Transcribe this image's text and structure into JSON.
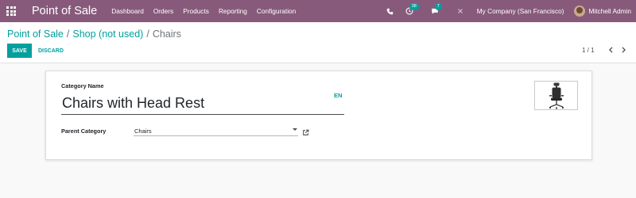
{
  "navbar": {
    "app_title": "Point of Sale",
    "menu": [
      "Dashboard",
      "Orders",
      "Products",
      "Reporting",
      "Configuration"
    ],
    "activity_count": "38",
    "message_count": "7",
    "company": "My Company (San Francisco)",
    "user": "Mitchell Admin",
    "icons": [
      "apps-icon",
      "phone-icon",
      "clock-icon",
      "chat-icon",
      "close-icon",
      "avatar"
    ],
    "colors": {
      "bar": "#875a7b",
      "badge": "#00a09d"
    }
  },
  "breadcrumb": {
    "items": [
      "Point of Sale",
      "Shop (not used)"
    ],
    "current": "Chairs"
  },
  "buttons": {
    "save": "SAVE",
    "discard": "DISCARD"
  },
  "pager": {
    "value": "1 / 1"
  },
  "form": {
    "name_label": "Category Name",
    "name_value": "Chairs with Head Rest",
    "lang": "EN",
    "parent_label": "Parent Category",
    "parent_value": "Chairs",
    "image_icon": "office-chair-image"
  },
  "colors": {
    "primary": "#00a09d"
  }
}
